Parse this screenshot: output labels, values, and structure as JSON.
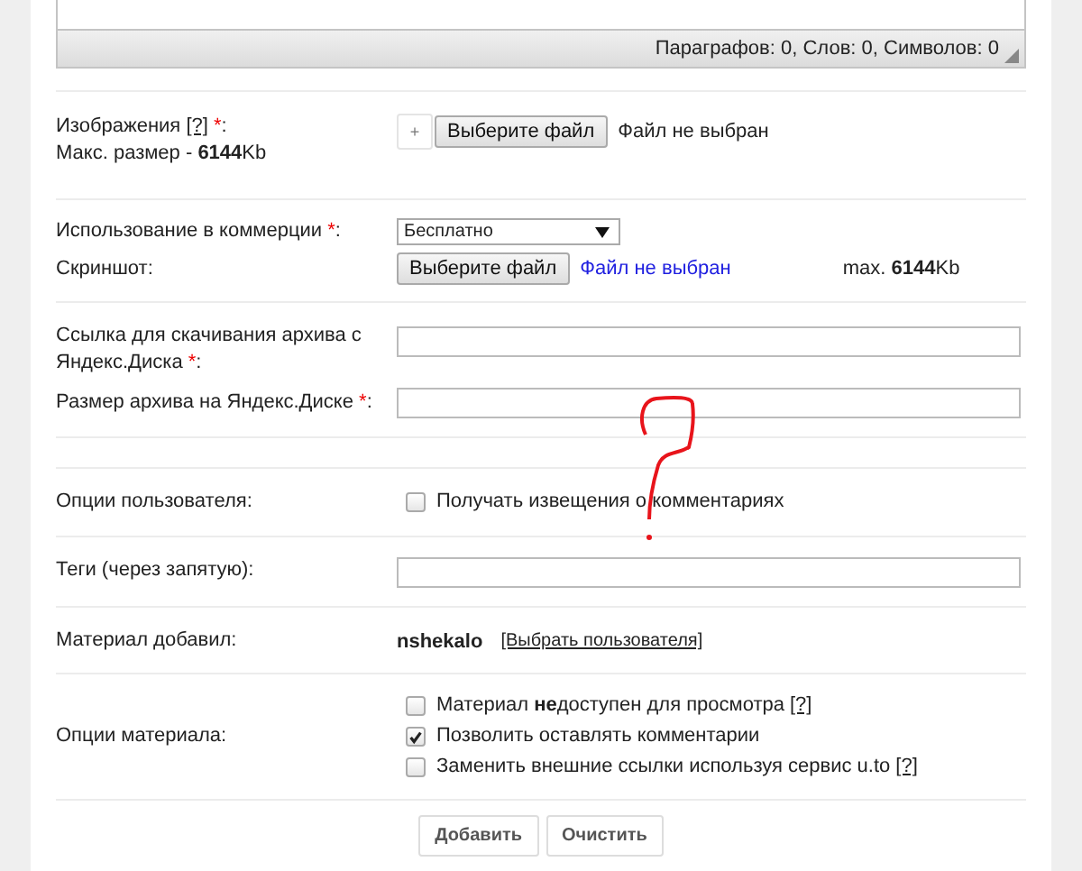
{
  "editor": {
    "status": "Параграфов: 0, Слов: 0, Символов: 0"
  },
  "images": {
    "label": [
      {
        "text": "Изображения "
      },
      {
        "text": "[?]",
        "kind": "help"
      },
      {
        "text": " *",
        "kind": "required"
      },
      {
        "text": ":"
      }
    ],
    "max_size": "Макс. размер - **6144**Kb",
    "add_button": "+",
    "file_button": "Выберите файл",
    "file_status": "Файл не выбран"
  },
  "commercial": {
    "label": [
      {
        "text": "Использование в коммерции"
      },
      {
        "text": " *",
        "kind": "required"
      },
      {
        "text": ":"
      }
    ],
    "select_value": "Бесплатно"
  },
  "screenshot": {
    "label": "Скриншот:",
    "file_button": "Выберите файл",
    "file_status": "Файл не выбран",
    "max_size": "max. **6144**Kb"
  },
  "archive_link": {
    "label": [
      {
        "text": "Ссылка для скачивания архива с Яндекс.Диска"
      },
      {
        "text": " *",
        "kind": "required"
      },
      {
        "text": ":"
      }
    ]
  },
  "archive_size": {
    "label": [
      {
        "text": "Размер архива на Яндекс.Диске"
      },
      {
        "text": " *",
        "kind": "required"
      },
      {
        "text": ":"
      }
    ]
  },
  "user_options": {
    "label": "Опции пользователя:",
    "checkboxes": [
      {
        "label": "Получать извещения о комментариях",
        "checked": false
      }
    ]
  },
  "tags": {
    "label": "Теги (через запятую):"
  },
  "author": {
    "label": "Материал добавил:",
    "name": "nshekalo",
    "link": "[Выбрать пользователя]"
  },
  "material_options": {
    "label": "Опции материала:",
    "checkboxes": [
      {
        "label": "Материал **не**доступен для просмотра",
        "help": "[?]",
        "checked": false
      },
      {
        "label": "Позволить оставлять комментарии",
        "checked": true
      },
      {
        "label": "Заменить внешние ссылки используя сервис u.to",
        "help": "[?]",
        "checked": false
      }
    ]
  },
  "buttons": [
    "Добавить",
    "Очистить"
  ]
}
